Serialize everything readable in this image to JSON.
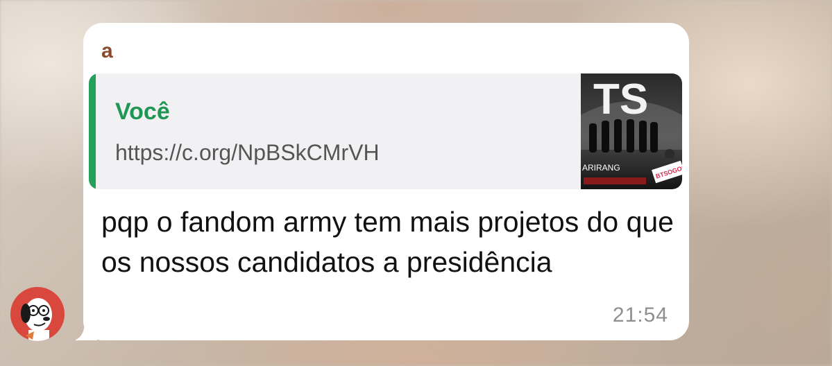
{
  "chat": {
    "message": {
      "sender_name": "a",
      "quote": {
        "author": "Você",
        "text": "https://c.org/NpBSkCMrVH",
        "thumbnail_caption": "ARIRANG",
        "thumbnail_sign": "BTSOGOG"
      },
      "text": "pqp o fandom army tem mais projetos do que os nossos candidatos a presidência",
      "time": "21:54"
    },
    "colors": {
      "bubble": "#ffffff",
      "quote_bar": "#25a05b",
      "quote_author": "#1f9653",
      "sender": "#8a4a2c"
    },
    "avatar_icon": "cartoon-character-avatar"
  }
}
